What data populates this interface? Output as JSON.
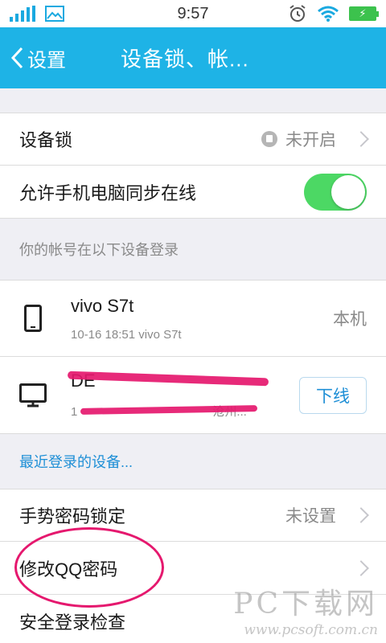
{
  "status_bar": {
    "time": "9:57",
    "battery_icon": "charging-battery-icon"
  },
  "nav": {
    "back_label": "设置",
    "title": "设备锁、帐..."
  },
  "device_lock": {
    "title": "设备锁",
    "value": "未开启"
  },
  "sync_online": {
    "title": "允许手机电脑同步在线",
    "enabled": true
  },
  "devices_section": {
    "header": "你的帐号在以下设备登录",
    "devices": [
      {
        "name": "vivo S7t",
        "detail": "10-16 18:51 vivo S7t",
        "status": "本机",
        "icon": "phone-icon"
      },
      {
        "name": "DE",
        "detail": "1",
        "detail_tail": "沧州...",
        "action": "下线",
        "icon": "monitor-icon"
      }
    ],
    "recent_link": "最近登录的设备..."
  },
  "gesture_lock": {
    "title": "手势密码锁定",
    "value": "未设置"
  },
  "change_password": {
    "title": "修改QQ密码"
  },
  "security_check": {
    "title": "安全登录检查"
  },
  "watermark": {
    "brand": "PC下载网",
    "url": "www.pcsoft.com.cn"
  },
  "colors": {
    "accent": "#1eb3e6",
    "toggle_on": "#4cd864",
    "link": "#1e8fd6",
    "annotation": "#e5186e"
  }
}
